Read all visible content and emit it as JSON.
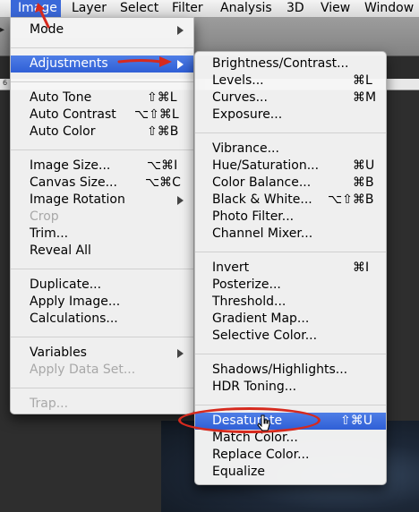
{
  "menubar": {
    "items": [
      "Image",
      "Layer",
      "Select",
      "Filter",
      "Analysis",
      "3D",
      "View",
      "Window"
    ]
  },
  "ruler": {
    "label": "6"
  },
  "image_menu": {
    "mode": "Mode",
    "adjustments": "Adjustments",
    "auto_tone": {
      "label": "Auto Tone",
      "shortcut": "⇧⌘L"
    },
    "auto_contrast": {
      "label": "Auto Contrast",
      "shortcut": "⌥⇧⌘L"
    },
    "auto_color": {
      "label": "Auto Color",
      "shortcut": "⇧⌘B"
    },
    "image_size": {
      "label": "Image Size...",
      "shortcut": "⌥⌘I"
    },
    "canvas_size": {
      "label": "Canvas Size...",
      "shortcut": "⌥⌘C"
    },
    "image_rotation": "Image Rotation",
    "crop": "Crop",
    "trim": "Trim...",
    "reveal_all": "Reveal All",
    "duplicate": "Duplicate...",
    "apply_image": "Apply Image...",
    "calculations": "Calculations...",
    "variables": "Variables",
    "apply_data_set": "Apply Data Set...",
    "trap": "Trap..."
  },
  "adjustments_menu": {
    "brightness_contrast": {
      "label": "Brightness/Contrast...",
      "shortcut": ""
    },
    "levels": {
      "label": "Levels...",
      "shortcut": "⌘L"
    },
    "curves": {
      "label": "Curves...",
      "shortcut": "⌘M"
    },
    "exposure": {
      "label": "Exposure...",
      "shortcut": ""
    },
    "vibrance": {
      "label": "Vibrance...",
      "shortcut": ""
    },
    "hue_saturation": {
      "label": "Hue/Saturation...",
      "shortcut": "⌘U"
    },
    "color_balance": {
      "label": "Color Balance...",
      "shortcut": "⌘B"
    },
    "black_white": {
      "label": "Black & White...",
      "shortcut": "⌥⇧⌘B"
    },
    "photo_filter": {
      "label": "Photo Filter...",
      "shortcut": ""
    },
    "channel_mixer": {
      "label": "Channel Mixer...",
      "shortcut": ""
    },
    "invert": {
      "label": "Invert",
      "shortcut": "⌘I"
    },
    "posterize": {
      "label": "Posterize...",
      "shortcut": ""
    },
    "threshold": {
      "label": "Threshold...",
      "shortcut": ""
    },
    "gradient_map": {
      "label": "Gradient Map...",
      "shortcut": ""
    },
    "selective_color": {
      "label": "Selective Color...",
      "shortcut": ""
    },
    "shadows_highlights": {
      "label": "Shadows/Highlights...",
      "shortcut": ""
    },
    "hdr_toning": {
      "label": "HDR Toning...",
      "shortcut": ""
    },
    "desaturate": {
      "label": "Desaturate",
      "shortcut": "⇧⌘U"
    },
    "match_color": {
      "label": "Match Color...",
      "shortcut": ""
    },
    "replace_color": {
      "label": "Replace Color...",
      "shortcut": ""
    },
    "equalize": {
      "label": "Equalize",
      "shortcut": ""
    }
  },
  "colors": {
    "selection": "#2f5fd6",
    "annotation_red": "#d62a1e",
    "disabled_text": "#a8a8a8"
  },
  "icons": [
    "submenu-arrow-icon",
    "annotation-arrow-icon",
    "pointer-cursor-icon",
    "tool-chevron-icon"
  ]
}
